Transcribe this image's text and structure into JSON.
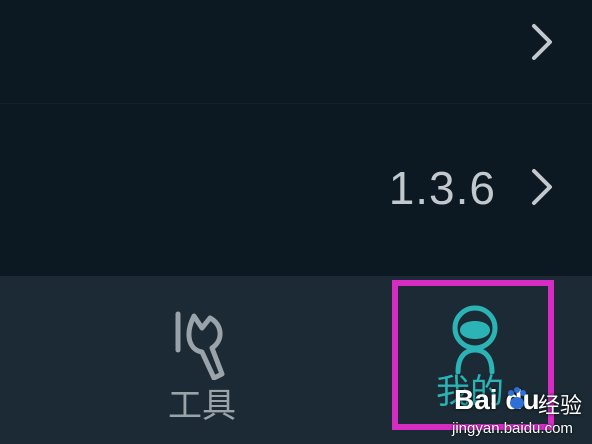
{
  "settings_list": {
    "rows": [
      {
        "value": ""
      },
      {
        "value": "1.3.6"
      }
    ]
  },
  "tab_bar": {
    "tabs": [
      {
        "label": "工具",
        "icon": "wrench-icon",
        "active": false
      },
      {
        "label": "我的",
        "icon": "user-icon",
        "active": true
      }
    ]
  },
  "highlight_color": "#d62cc4",
  "accent_color": "#2bb3b6",
  "watermark": {
    "brand": "Bai  du",
    "suffix": "经验",
    "url": "jingyan.baidu.com"
  }
}
